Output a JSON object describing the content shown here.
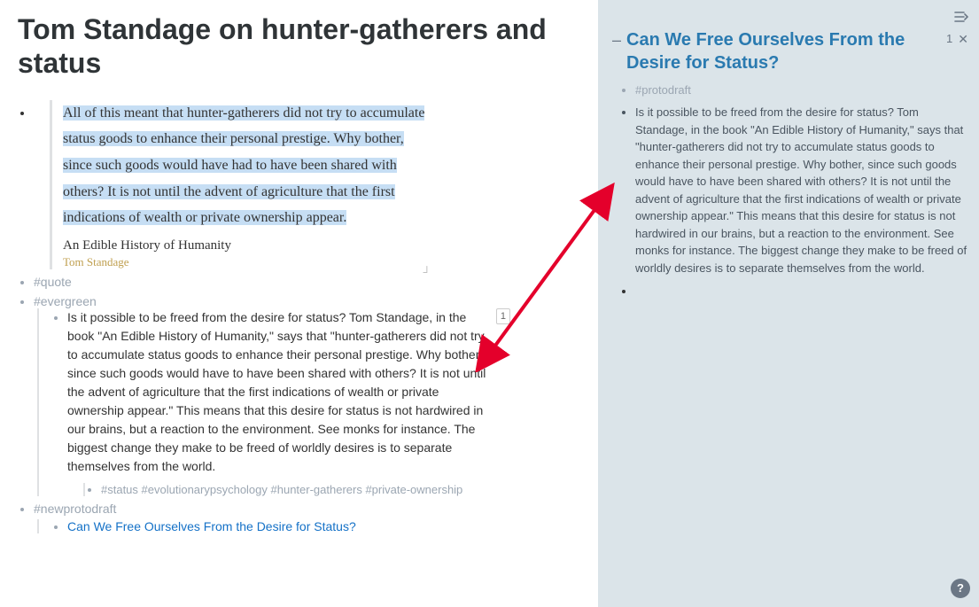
{
  "main": {
    "title": "Tom Standage on hunter-gatherers and status",
    "quote": {
      "highlighted": "All of this meant that hunter-gatherers did not try to accumulate status goods to enhance their personal prestige. Why bother, since such goods would have had to have been shared with others? It is not until the advent of agriculture that the first indications of wealth or private ownership appear.",
      "book": "An Edible History of Humanity",
      "author": "Tom Standage"
    },
    "tags": {
      "quote": "#quote",
      "evergreen": "#evergreen",
      "newprotodraft": "#newprotodraft"
    },
    "evergreen": {
      "text": "Is it possible to be freed from the desire for status? Tom Standage, in the book \"An Edible History of Humanity,\" says that \"hunter-gatherers did not try to accumulate status goods to enhance their personal prestige. Why bother, since such goods would have to have been shared with others? It is not until the advent of agriculture that the first indications of wealth or private ownership appear.\" This means that this desire for status is not hardwired in our brains, but a reaction to the environment. See monks for instance. The biggest change they make to be freed of worldly desires is to separate themselves from the world.",
      "ref_count": "1",
      "subtags": "#status #evolutionarypsychology #hunter-gatherers #private-ownership"
    },
    "linked_note": "Can We Free Ourselves From the Desire for Status?"
  },
  "side": {
    "dash": "–",
    "title": "Can We Free Ourselves From the Desire for Status?",
    "count": "1",
    "close": "✕",
    "tag": "#protodraft",
    "para": "Is it possible to be freed from the desire for status? Tom Standage, in the book \"An Edible History of Humanity,\" says that \"hunter-gatherers did not try to accumulate status goods to enhance their personal prestige. Why bother, since such goods would have to have been shared with others? It is not until the advent of agriculture that the first indications of wealth or private ownership appear.\" This means that this desire for status is not hardwired in our brains, but a reaction to the environment. See monks for instance. The biggest change they make to be freed of worldly desires is to separate themselves from the world."
  },
  "help": "?"
}
